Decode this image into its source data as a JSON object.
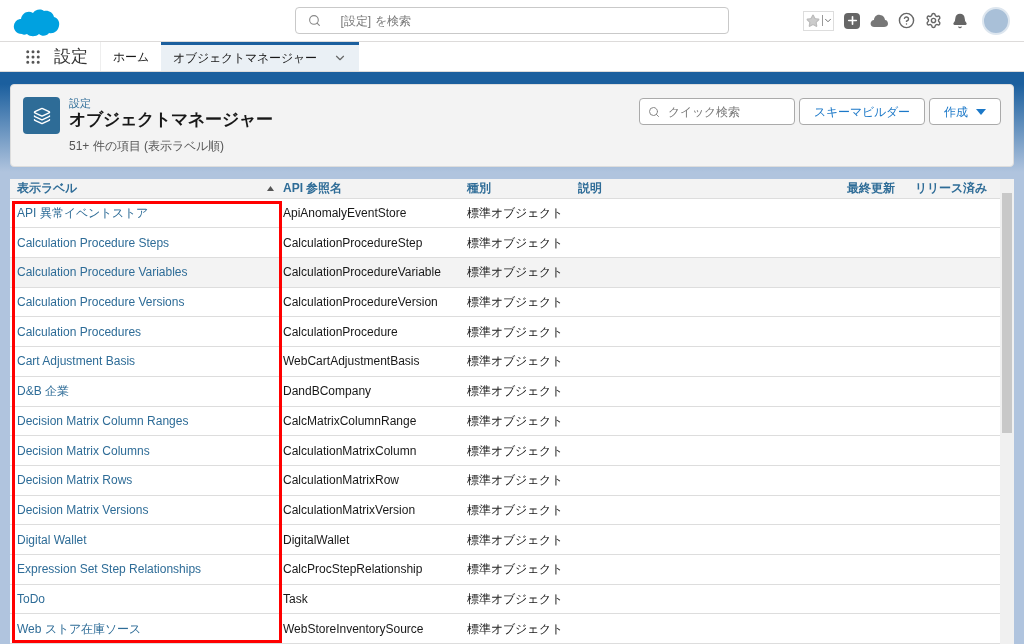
{
  "header": {
    "search_placeholder": "[設定] を検索"
  },
  "nav": {
    "app_name": "設定",
    "tabs": [
      {
        "label": "ホーム",
        "selected": false
      },
      {
        "label": "オブジェクトマネージャー",
        "selected": true
      }
    ]
  },
  "page_header": {
    "breadcrumb": "設定",
    "title": "オブジェクトマネージャー",
    "subtitle": "51+ 件の項目 (表示ラベル順)",
    "quick_search_placeholder": "クイック検索",
    "buttons": [
      {
        "label": "スキーマビルダー",
        "kind": "plain"
      },
      {
        "label": "作成",
        "kind": "menu"
      }
    ]
  },
  "table": {
    "columns": [
      {
        "label": "表示ラベル",
        "sorted": true
      },
      {
        "label": "API 参照名",
        "sorted": false
      },
      {
        "label": "種別",
        "sorted": false
      },
      {
        "label": "説明",
        "sorted": false
      },
      {
        "label": "最終更新",
        "sorted": false
      },
      {
        "label": "リリース済み",
        "sorted": false
      }
    ],
    "rows": [
      {
        "label": "API 異常イベントストア",
        "api_name": "ApiAnomalyEventStore",
        "type": "標準オブジェクト",
        "selected": false
      },
      {
        "label": "Calculation Procedure Steps",
        "api_name": "CalculationProcedureStep",
        "type": "標準オブジェクト",
        "selected": false
      },
      {
        "label": "Calculation Procedure Variables",
        "api_name": "CalculationProcedureVariable",
        "type": "標準オブジェクト",
        "selected": true
      },
      {
        "label": "Calculation Procedure Versions",
        "api_name": "CalculationProcedureVersion",
        "type": "標準オブジェクト",
        "selected": false
      },
      {
        "label": "Calculation Procedures",
        "api_name": "CalculationProcedure",
        "type": "標準オブジェクト",
        "selected": false
      },
      {
        "label": "Cart Adjustment Basis",
        "api_name": "WebCartAdjustmentBasis",
        "type": "標準オブジェクト",
        "selected": false
      },
      {
        "label": "D&B 企業",
        "api_name": "DandBCompany",
        "type": "標準オブジェクト",
        "selected": false
      },
      {
        "label": "Decision Matrix Column Ranges",
        "api_name": "CalcMatrixColumnRange",
        "type": "標準オブジェクト",
        "selected": false
      },
      {
        "label": "Decision Matrix Columns",
        "api_name": "CalculationMatrixColumn",
        "type": "標準オブジェクト",
        "selected": false
      },
      {
        "label": "Decision Matrix Rows",
        "api_name": "CalculationMatrixRow",
        "type": "標準オブジェクト",
        "selected": false
      },
      {
        "label": "Decision Matrix Versions",
        "api_name": "CalculationMatrixVersion",
        "type": "標準オブジェクト",
        "selected": false
      },
      {
        "label": "Digital Wallet",
        "api_name": "DigitalWallet",
        "type": "標準オブジェクト",
        "selected": false
      },
      {
        "label": "Expression Set Step Relationships",
        "api_name": "CalcProcStepRelationship",
        "type": "標準オブジェクト",
        "selected": false
      },
      {
        "label": "ToDo",
        "api_name": "Task",
        "type": "標準オブジェクト",
        "selected": false
      },
      {
        "label": "Web ストア在庫ソース",
        "api_name": "WebStoreInventorySource",
        "type": "標準オブジェクト",
        "selected": false
      }
    ]
  }
}
